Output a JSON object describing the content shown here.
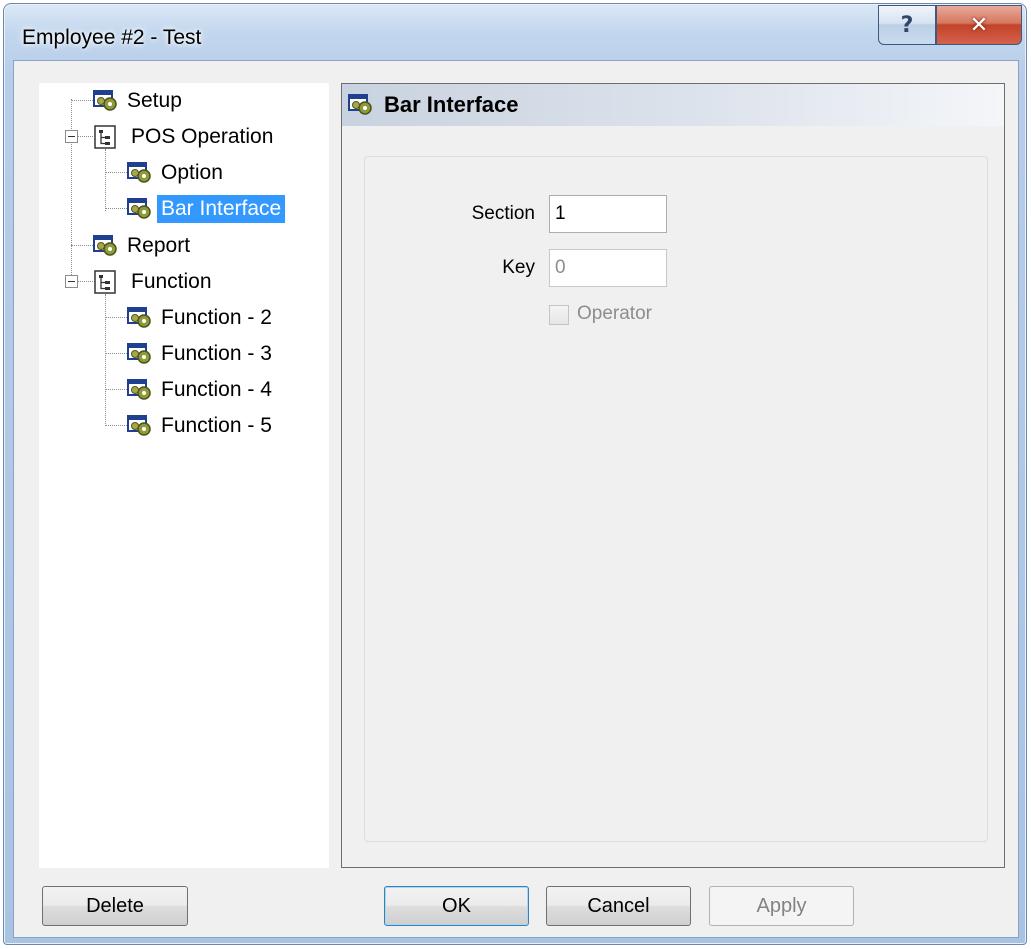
{
  "window": {
    "title": "Employee #2 - Test",
    "help_glyph": "?",
    "close_glyph": "✕"
  },
  "tree": {
    "items": [
      {
        "label": "Setup",
        "icon": "gear-window-icon",
        "selected": false
      },
      {
        "label": "POS Operation",
        "icon": "tree-folder-icon",
        "selected": false,
        "expanded": true
      },
      {
        "label": "Option",
        "icon": "gear-window-icon",
        "selected": false
      },
      {
        "label": "Bar Interface",
        "icon": "gear-window-icon",
        "selected": true
      },
      {
        "label": "Report",
        "icon": "gear-window-icon",
        "selected": false
      },
      {
        "label": "Function",
        "icon": "tree-folder-icon",
        "selected": false,
        "expanded": true
      },
      {
        "label": "Function - 2",
        "icon": "gear-window-icon",
        "selected": false
      },
      {
        "label": "Function - 3",
        "icon": "gear-window-icon",
        "selected": false
      },
      {
        "label": "Function - 4",
        "icon": "gear-window-icon",
        "selected": false
      },
      {
        "label": "Function - 5",
        "icon": "gear-window-icon",
        "selected": false
      }
    ]
  },
  "page": {
    "title": "Bar Interface",
    "section_label": "Section",
    "section_value": "1",
    "key_label": "Key",
    "key_value": "0",
    "operator_label": "Operator",
    "operator_checked": false
  },
  "buttons": {
    "delete": "Delete",
    "ok": "OK",
    "cancel": "Cancel",
    "apply": "Apply"
  },
  "colors": {
    "selection": "#3399ff",
    "frame": "#b7cde9"
  }
}
